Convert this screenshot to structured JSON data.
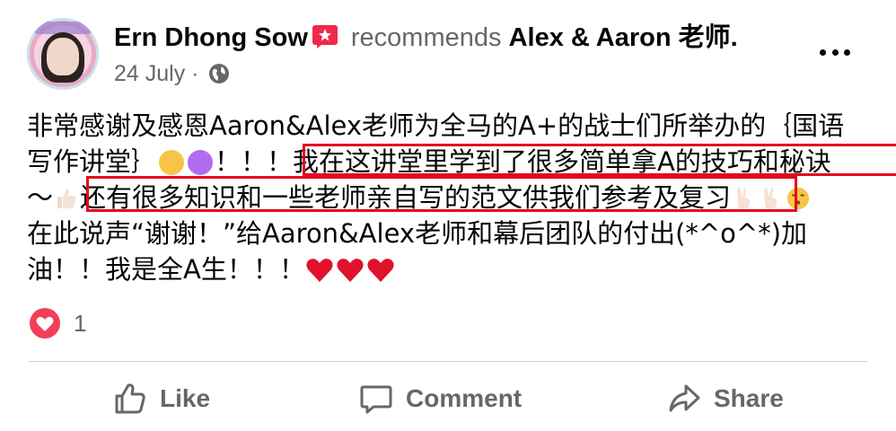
{
  "post": {
    "author": "Ern Dhong Sow",
    "verb": "recommends",
    "page_name": "Alex & Aaron 老师.",
    "date": "24 July",
    "separator": "·"
  },
  "icons": {
    "recommend": "recommend-flag-icon",
    "privacy": "globe-icon",
    "more": "more-options-icon",
    "like": "like-icon",
    "comment": "comment-icon",
    "share": "share-icon",
    "reaction": "love-reaction-icon"
  },
  "body": {
    "line1": "非常感谢及感恩Aaron&Alex老师为全马的A+的战士们所举办的｛国语",
    "line2_a": "写作讲堂｝",
    "line2_b": "！！！",
    "line2_c": "我在这讲堂里学到了很多简单拿A的技巧和秘诀",
    "line3_a": "～",
    "line3_b": "还有很多知识和一些老师亲自写的范文供我们参考及复习",
    "line4": "在此说声“谢谢！”给Aaron&Alex老师和幕后团队的付出(*^o^*)加",
    "line5": "油！！我是全A生！！！"
  },
  "highlight_color": "#e3081d",
  "reactions": {
    "count": "1"
  },
  "actions": {
    "like": "Like",
    "comment": "Comment",
    "share": "Share"
  },
  "colors": {
    "text": "#050505",
    "secondary": "#65676b",
    "love": "#f33e58",
    "recommend": "#f02849"
  }
}
